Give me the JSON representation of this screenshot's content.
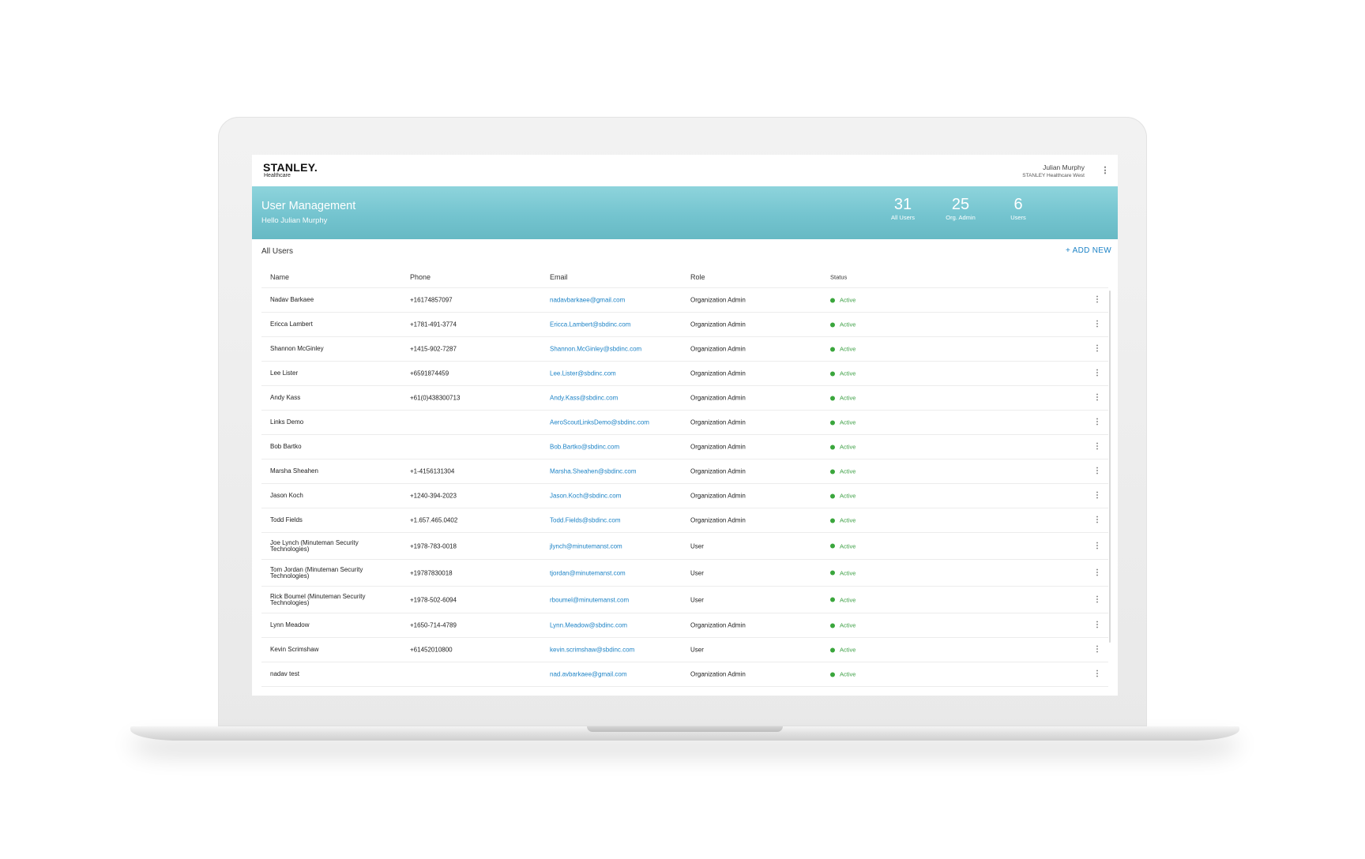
{
  "app": {
    "logo_word": "STANLEY.",
    "logo_sub": "Healthcare",
    "user_name": "Julian Murphy",
    "user_org": "STANLEY Healthcare West"
  },
  "hero": {
    "title": "User Management",
    "subtitle": "Hello Julian Murphy",
    "stats": [
      {
        "value": "31",
        "label": "All Users"
      },
      {
        "value": "25",
        "label": "Org. Admin"
      },
      {
        "value": "6",
        "label": "Users"
      }
    ]
  },
  "list": {
    "title": "All Users",
    "add_label": "+ ADD NEW",
    "columns": [
      "Name",
      "Phone",
      "Email",
      "Role",
      "Status"
    ],
    "rows": [
      {
        "name": "Nadav Barkaee",
        "phone": "+16174857097",
        "email": "nadavbarkaee@gmail.com",
        "role": "Organization Admin",
        "status": "Active"
      },
      {
        "name": "Ericca Lambert",
        "phone": "+1781-491-3774",
        "email": "Ericca.Lambert@sbdinc.com",
        "role": "Organization Admin",
        "status": "Active"
      },
      {
        "name": "Shannon McGinley",
        "phone": "+1415-902-7287",
        "email": "Shannon.McGinley@sbdinc.com",
        "role": "Organization Admin",
        "status": "Active"
      },
      {
        "name": "Lee Lister",
        "phone": "+6591874459",
        "email": "Lee.Lister@sbdinc.com",
        "role": "Organization Admin",
        "status": "Active"
      },
      {
        "name": "Andy Kass",
        "phone": "+61(0)438300713",
        "email": "Andy.Kass@sbdinc.com",
        "role": "Organization Admin",
        "status": "Active"
      },
      {
        "name": "Links Demo",
        "phone": "",
        "email": "AeroScoutLinksDemo@sbdinc.com",
        "role": "Organization Admin",
        "status": "Active"
      },
      {
        "name": "Bob Bartko",
        "phone": "",
        "email": "Bob.Bartko@sbdinc.com",
        "role": "Organization Admin",
        "status": "Active"
      },
      {
        "name": "Marsha Sheahen",
        "phone": "+1-4156131304",
        "email": "Marsha.Sheahen@sbdinc.com",
        "role": "Organization Admin",
        "status": "Active"
      },
      {
        "name": "Jason Koch",
        "phone": "+1240-394-2023",
        "email": "Jason.Koch@sbdinc.com",
        "role": "Organization Admin",
        "status": "Active"
      },
      {
        "name": "Todd Fields",
        "phone": "+1.657.465.0402",
        "email": "Todd.Fields@sbdinc.com",
        "role": "Organization Admin",
        "status": "Active"
      },
      {
        "name": "Joe Lynch (Minuteman Security Technologies)",
        "phone": "+1978-783-0018",
        "email": "jlynch@minutemanst.com",
        "role": "User",
        "status": "Active"
      },
      {
        "name": "Tom Jordan (Minuteman Security Technologies)",
        "phone": "+19787830018",
        "email": "tjordan@minutemanst.com",
        "role": "User",
        "status": "Active"
      },
      {
        "name": "Rick Boumel (Minuteman Security Technologies)",
        "phone": "+1978-502-6094",
        "email": "rboumel@minutemanst.com",
        "role": "User",
        "status": "Active"
      },
      {
        "name": "Lynn Meadow",
        "phone": "+1650-714-4789",
        "email": "Lynn.Meadow@sbdinc.com",
        "role": "Organization Admin",
        "status": "Active"
      },
      {
        "name": "Kevin Scrimshaw",
        "phone": "+61452010800",
        "email": "kevin.scrimshaw@sbdinc.com",
        "role": "User",
        "status": "Active"
      },
      {
        "name": "nadav test",
        "phone": "",
        "email": "nad.avbarkaee@gmail.com",
        "role": "Organization Admin",
        "status": "Active"
      }
    ]
  },
  "colors": {
    "accent": "#1d83c6",
    "header_teal": "#74c4cf",
    "status_active": "#3aa63c"
  },
  "icons": {
    "menu": "more-vert-icon",
    "status": "status-dot-icon"
  }
}
